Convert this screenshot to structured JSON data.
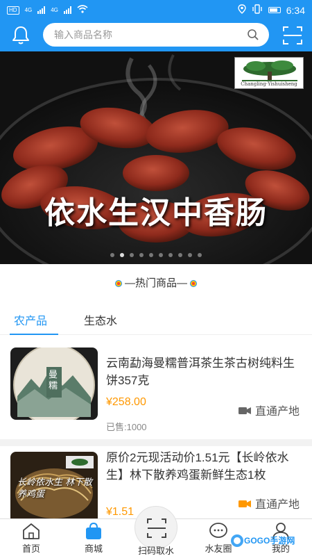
{
  "status_bar": {
    "left_labels": [
      "HD",
      "4G",
      "4G"
    ],
    "time": "6:34"
  },
  "header": {
    "search_placeholder": "输入商品名称",
    "icons": [
      "bell-icon",
      "search-icon",
      "scan-icon"
    ]
  },
  "banner": {
    "title": "依水生汉中香肠",
    "logo_text": "Changling·Yishuisheng",
    "dot_count": 10,
    "active_dot_index": 1
  },
  "section": {
    "title": "—热门商品—"
  },
  "tabs": [
    {
      "label": "农产品",
      "active": true
    },
    {
      "label": "生态水",
      "active": false
    }
  ],
  "products": [
    {
      "title": "云南勐海曼糯普洱茶生茶古树纯料生饼357克",
      "price": "¥258.00",
      "origin": "直通产地",
      "sold": "已售:1000",
      "thumb_text": "曼糯"
    },
    {
      "title": "原价2元现活动价1.51元【长岭依水生】林下散养鸡蛋新鲜生态1枚",
      "price": "¥1.51",
      "origin": "直通产地",
      "thumb_text": "长岭依水生 林下散养鸡蛋"
    }
  ],
  "bottom_nav": [
    {
      "label": "首页",
      "icon": "home-icon"
    },
    {
      "label": "商城",
      "icon": "shopping-bag-icon",
      "active": true
    },
    {
      "label": "扫码取水",
      "icon": "scan-icon"
    },
    {
      "label": "水友圈",
      "icon": "chat-icon"
    },
    {
      "label": "我的",
      "icon": "user-icon"
    }
  ],
  "watermark": "GOGO手游网",
  "colors": {
    "primary": "#2196f3",
    "price": "#ff9800",
    "origin_icon_1": "#666666",
    "origin_icon_2": "#ff9800"
  }
}
